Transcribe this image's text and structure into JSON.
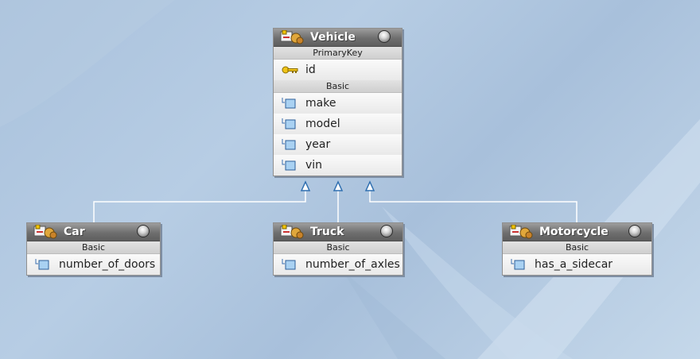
{
  "colors": {
    "header_top": "#9d9d9d",
    "header_bottom": "#5d5d5d",
    "body_bg": "#ececec",
    "connector": "#ffffff",
    "arrow": "#2f6fb0"
  },
  "entities": {
    "vehicle": {
      "title": "Vehicle",
      "primary_key_label": "PrimaryKey",
      "primary_key": "id",
      "basic_label": "Basic",
      "attributes": [
        "make",
        "model",
        "year",
        "vin"
      ]
    },
    "car": {
      "title": "Car",
      "basic_label": "Basic",
      "attributes": [
        "number_of_doors"
      ]
    },
    "truck": {
      "title": "Truck",
      "basic_label": "Basic",
      "attributes": [
        "number_of_axles"
      ]
    },
    "motorcycle": {
      "title": "Motorcycle",
      "basic_label": "Basic",
      "attributes": [
        "has_a_sidecar"
      ]
    }
  },
  "icons": {
    "entity": "entity-icon",
    "primary_key": "key-icon",
    "attribute": "attribute-icon",
    "collapse": "collapse-button-icon",
    "inheritance": "inheritance-arrow-icon"
  }
}
